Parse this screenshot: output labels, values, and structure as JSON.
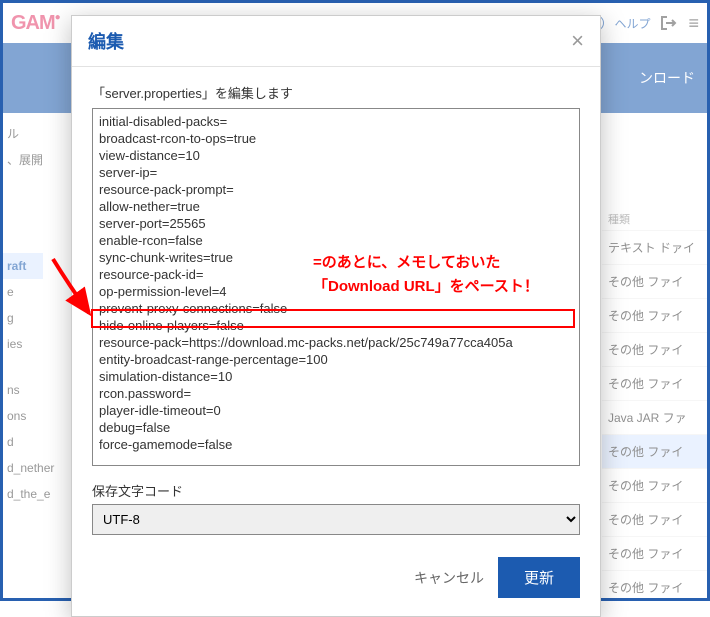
{
  "topbar": {
    "logo_part1": "GAM",
    "logo_suffix": "▾",
    "help": "ヘルプ"
  },
  "bluebar": {
    "download": "ンロード"
  },
  "leftpanel": {
    "item0": "ル",
    "item1": "、展開",
    "selected": "raft",
    "item2": "e",
    "item3": "g",
    "item4": "ies",
    "item5": "ns",
    "item6": "ons",
    "item7": "d",
    "item8": "d_nether",
    "item9": "d_the_e"
  },
  "rightpanel": {
    "hdr1": "種類",
    "row0": "テキスト ドァイ",
    "row1": "その他 ファイ",
    "row2": "その他 ファイ",
    "row3": "その他 ファイ",
    "row4": "その他 ファイ",
    "row5": "Java JAR ファ",
    "row6": "その他 ファイ",
    "row7": "その他 ファイ",
    "row8": "その他 ファイ",
    "row9": "その他 ファイ",
    "row10": "その他 ファイ"
  },
  "modal": {
    "title": "編集",
    "desc": "「server.properties」を編集します",
    "textarea": "initial-disabled-packs=\nbroadcast-rcon-to-ops=true\nview-distance=10\nserver-ip=\nresource-pack-prompt=\nallow-nether=true\nserver-port=25565\nenable-rcon=false\nsync-chunk-writes=true\nresource-pack-id=\nop-permission-level=4\nprevent-proxy-connections=false\nhide-online-players=false\nresource-pack=https://download.mc-packs.net/pack/25c749a77cca405a\nentity-broadcast-range-percentage=100\nsimulation-distance=10\nrcon.password=\nplayer-idle-timeout=0\ndebug=false\nforce-gamemode=false",
    "enc_label": "保存文字コード",
    "enc_value": "UTF-8",
    "cancel": "キャンセル",
    "update": "更新"
  },
  "annotation": {
    "line1": "=のあとに、メモしておいた",
    "line2": "「Download URL」をペースト！"
  }
}
